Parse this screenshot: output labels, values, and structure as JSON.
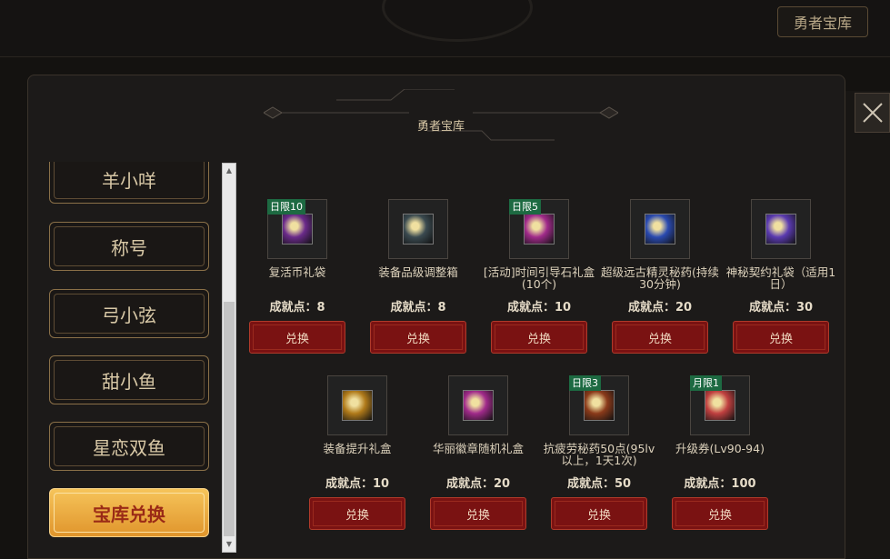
{
  "header": {
    "tab_label": "勇者宝库"
  },
  "panel": {
    "title": "勇者宝库"
  },
  "sidebar": {
    "items": [
      {
        "label": "羊小咩",
        "active": false
      },
      {
        "label": "称号",
        "active": false
      },
      {
        "label": "弓小弦",
        "active": false
      },
      {
        "label": "甜小鱼",
        "active": false
      },
      {
        "label": "星恋双鱼",
        "active": false
      },
      {
        "label": "宝库兑换",
        "active": true
      }
    ]
  },
  "shop": {
    "points_prefix": "成就点：",
    "exchange_label": "兑换",
    "items": [
      {
        "name": "复活币礼袋",
        "points": "成就点：8",
        "limit": "日限10",
        "icon": "revive-coin-bag-icon",
        "color": "#6a2a8a"
      },
      {
        "name": "装备品级调整箱",
        "points": "成就点：8",
        "limit": "",
        "icon": "equipment-grade-box-icon",
        "color": "#3a4a50"
      },
      {
        "name": "[活动]时间引导石礼盒 (10个)",
        "points": "成就点：10",
        "limit": "日限5",
        "icon": "time-stone-gift-icon",
        "color": "#a02a8a"
      },
      {
        "name": "超级远古精灵秘药(持续30分钟)",
        "points": "成就点：20",
        "limit": "",
        "icon": "ancient-elixir-icon",
        "color": "#2a4ab0"
      },
      {
        "name": "神秘契约礼袋（适用1日）",
        "points": "成就点：30",
        "limit": "",
        "icon": "mystic-contract-bag-icon",
        "color": "#5a3ab0"
      },
      {
        "name": "装备提升礼盒",
        "points": "成就点：10",
        "limit": "",
        "icon": "equipment-upgrade-box-icon",
        "color": "#b07a1a"
      },
      {
        "name": "华丽徽章随机礼盒",
        "points": "成就点：20",
        "limit": "",
        "icon": "emblem-random-box-icon",
        "color": "#a02a8a"
      },
      {
        "name": "抗疲劳秘药50点(95lv以上，1天1次)",
        "points": "成就点：50",
        "limit": "日限3",
        "icon": "fatigue-potion-icon",
        "color": "#8a3a1a"
      },
      {
        "name": "升级券(Lv90-94)",
        "points": "成就点：100",
        "limit": "月限1",
        "icon": "level-up-ticket-icon",
        "color": "#c04040"
      }
    ]
  }
}
